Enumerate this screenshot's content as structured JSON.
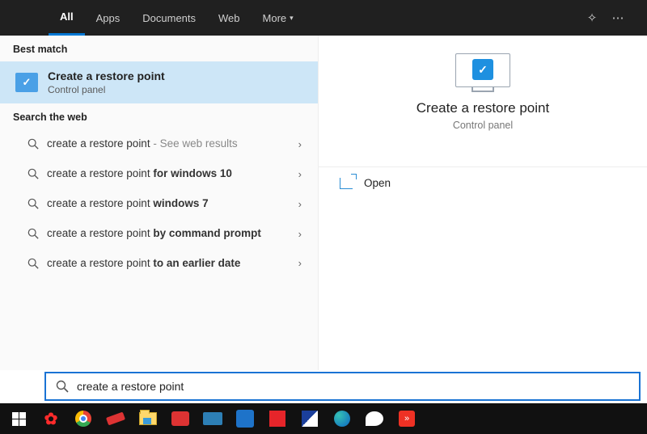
{
  "topbar": {
    "tabs": [
      "All",
      "Apps",
      "Documents",
      "Web",
      "More"
    ],
    "active_index": 0
  },
  "left_panel": {
    "best_match_header": "Best match",
    "best_match": {
      "title": "Create a restore point",
      "subtitle": "Control panel"
    },
    "web_header": "Search the web",
    "web_results": [
      {
        "prefix": "create a restore point",
        "suffix": "",
        "hint": " - See web results"
      },
      {
        "prefix": "create a restore point ",
        "suffix": "for windows 10",
        "hint": ""
      },
      {
        "prefix": "create a restore point ",
        "suffix": "windows 7",
        "hint": ""
      },
      {
        "prefix": "create a restore point ",
        "suffix": "by command prompt",
        "hint": ""
      },
      {
        "prefix": "create a restore point ",
        "suffix": "to an earlier date",
        "hint": ""
      }
    ]
  },
  "preview": {
    "title": "Create a restore point",
    "subtitle": "Control panel",
    "actions": [
      {
        "label": "Open",
        "icon": "open-icon"
      }
    ]
  },
  "search": {
    "value": "create a restore point"
  },
  "taskbar": {
    "items": [
      "start-icon",
      "huawei-icon",
      "chrome-icon",
      "usb-icon",
      "file-explorer-icon",
      "pdf-icon",
      "disk-icon",
      "mail-icon",
      "red-app-icon",
      "contrast-icon",
      "edge-icon",
      "dove-icon",
      "anydesk-icon"
    ]
  }
}
